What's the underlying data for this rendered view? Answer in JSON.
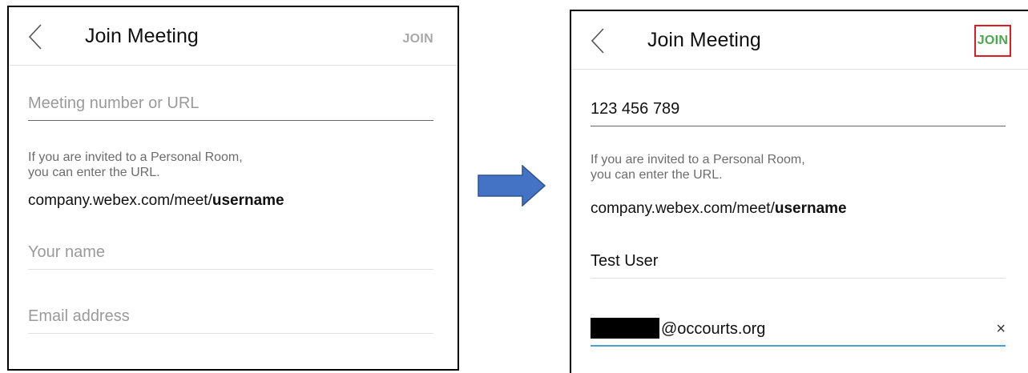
{
  "left_screen": {
    "header": {
      "title": "Join Meeting",
      "join_label": "JOIN"
    },
    "meeting_field": {
      "placeholder": "Meeting number or URL",
      "value": ""
    },
    "hint": {
      "line1": "If you are invited to a Personal Room,",
      "line2": "you can enter the URL."
    },
    "url_example": {
      "prefix": "company.webex.com/meet/",
      "bold": "username"
    },
    "name_field": {
      "placeholder": "Your name",
      "value": ""
    },
    "email_field": {
      "placeholder": "Email address",
      "value": ""
    }
  },
  "right_screen": {
    "header": {
      "title": "Join Meeting",
      "join_label": "JOIN",
      "join_color": "#4aa84c",
      "highlight_color": "#e01b22"
    },
    "meeting_field": {
      "value": "123 456 789"
    },
    "hint": {
      "line1": "If you are invited to a Personal Room,",
      "line2": "you can enter the URL."
    },
    "url_example": {
      "prefix": "company.webex.com/meet/",
      "bold": "username"
    },
    "name_field": {
      "value": "Test User"
    },
    "email_field": {
      "value_suffix": "@occourts.org",
      "clear_icon": "×"
    }
  },
  "arrow": {
    "icon": "right-arrow-icon",
    "color": "#4472c4"
  }
}
